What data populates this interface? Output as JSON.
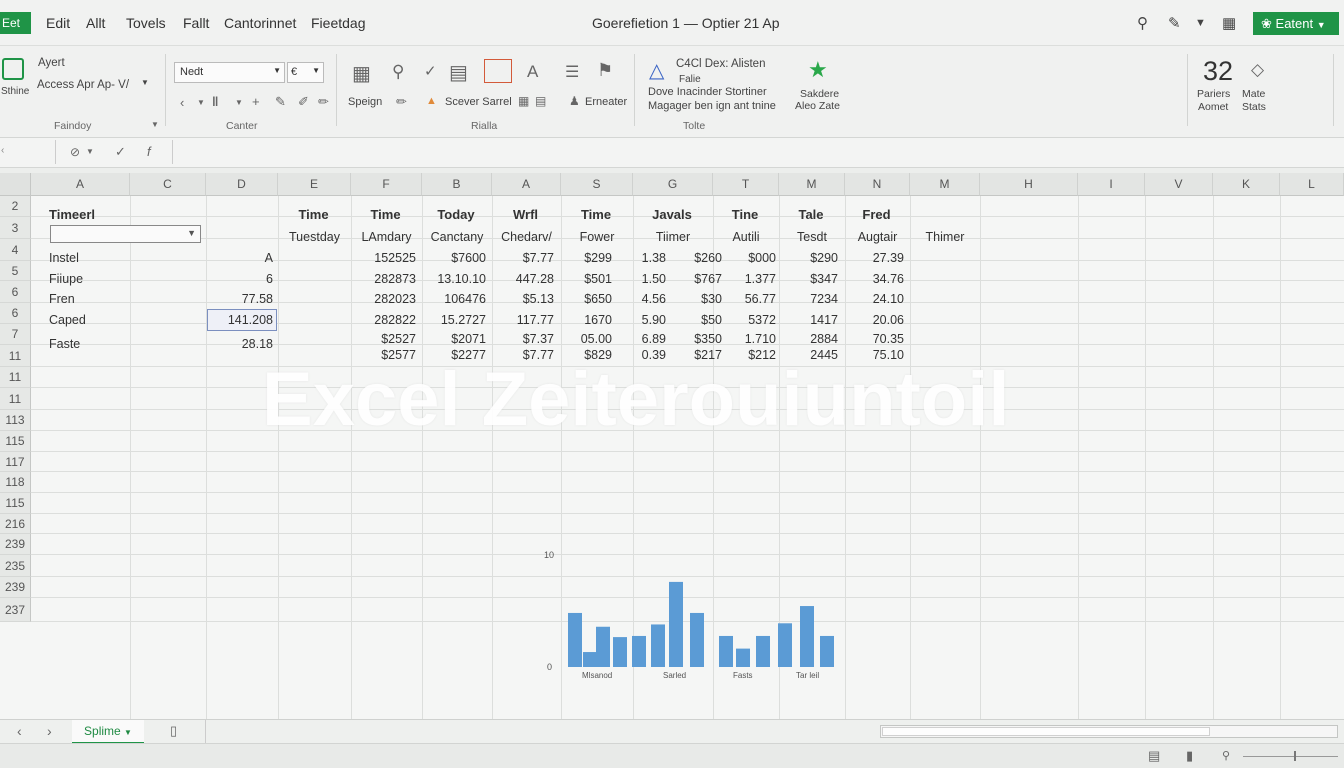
{
  "menubar": {
    "file_label": "Eet",
    "items": [
      "Edit",
      "Allt",
      "Tovels",
      "Fallt",
      "Cantorinnet",
      "Fieetdag"
    ],
    "title": "Goerefietion 1 — Optier 21 Ap",
    "export_label": "Eatent"
  },
  "ribbon": {
    "clipboard": {
      "paste_label": "Sthine",
      "line1": "Ayert",
      "line2": "Access Apr Ap- V/",
      "group": "Faindoy"
    },
    "font": {
      "font_name": "Nedt",
      "size": "",
      "group": "Canter"
    },
    "styles": {
      "speign": "Speign",
      "scever": "Scever Sarrel",
      "erneater": "Erneater",
      "group": "Rialla"
    },
    "editing": {
      "line1": "C4Cl Dex: Alisten",
      "line2": "Falie",
      "line3": "Dove Inacinder Stortiner",
      "line4": "Magager ben ign ant tnine",
      "group": "Tolte",
      "sakdere1": "Sakdere",
      "sakdere2": "Aleo Zate"
    },
    "number": {
      "value": "32",
      "label1": "Pariers",
      "label2": "Aomet",
      "label3": "Mate",
      "label4": "Stats"
    }
  },
  "columns": [
    "A",
    "C",
    "D",
    "E",
    "F",
    "B",
    "A",
    "S",
    "G",
    "T",
    "M",
    "N",
    "M",
    "H",
    "I",
    "V",
    "K",
    "L"
  ],
  "rows": [
    "2",
    "3",
    "4",
    "5",
    "6",
    "6",
    "7",
    "11",
    "11",
    "11",
    "113",
    "115",
    "117",
    "118",
    "115",
    "216",
    "239",
    "235",
    "239",
    "237"
  ],
  "table": {
    "header_a": "Timeerl",
    "headers": [
      "Time",
      "Time",
      "Today",
      "Wrfl",
      "Time",
      "Javals",
      "Tine",
      "Tale",
      "Fred"
    ],
    "subheaders": [
      "Tuestday",
      "LAmdary",
      "Canctany",
      "Chedarv/",
      "Fower",
      "Tiimer",
      "Autili",
      "Tesdt",
      "Augtair",
      "Thimer"
    ],
    "labels": [
      "Instel",
      "Fiiupe",
      "Fren",
      "Caped",
      "Faste"
    ],
    "colD": [
      "A",
      "6",
      "77.58",
      "141.208",
      "28.18"
    ],
    "data": [
      [
        "152525",
        "$7600",
        "$7.77",
        "$299",
        "1.38",
        "$260",
        "$000",
        "$290",
        "27.39"
      ],
      [
        "282873",
        "13.10.10",
        "447.28",
        "$501",
        "1.50",
        "$767",
        "1.377",
        "$347",
        "34.76"
      ],
      [
        "282023",
        "106476",
        "$5.13",
        "$650",
        "4.56",
        "$30",
        "56.77",
        "7234",
        "24.10"
      ],
      [
        "282822",
        "15.2727",
        "117.77",
        "1670",
        "5.90",
        "$50",
        "5372",
        "1417",
        "20.06"
      ],
      [
        "$2527",
        "$2071",
        "$7.37",
        "05.00",
        "6.89",
        "$350",
        "1.710",
        "2884",
        "70.35"
      ],
      [
        "$2577",
        "$2277",
        "$7.77",
        "$829",
        "0.39",
        "$217",
        "$212",
        "2445",
        "75.10"
      ]
    ]
  },
  "watermark": "Excel Zeiterouiuntoil",
  "chart_data": {
    "type": "bar",
    "ylim": [
      0,
      10
    ],
    "yticks": [
      "10",
      "0"
    ],
    "values": [
      4.7,
      1.3,
      3.5,
      2.6,
      2.7,
      3.7,
      7.4,
      4.7,
      2.7,
      1.6,
      2.7,
      3.8,
      5.3,
      2.7
    ],
    "xlabels": [
      "Mlsanod",
      "Sarled",
      "Fasts",
      "Tar leil"
    ],
    "color": "#5b9bd5"
  },
  "tabs": {
    "sheet": "Splime"
  },
  "accent": "#1f9447"
}
